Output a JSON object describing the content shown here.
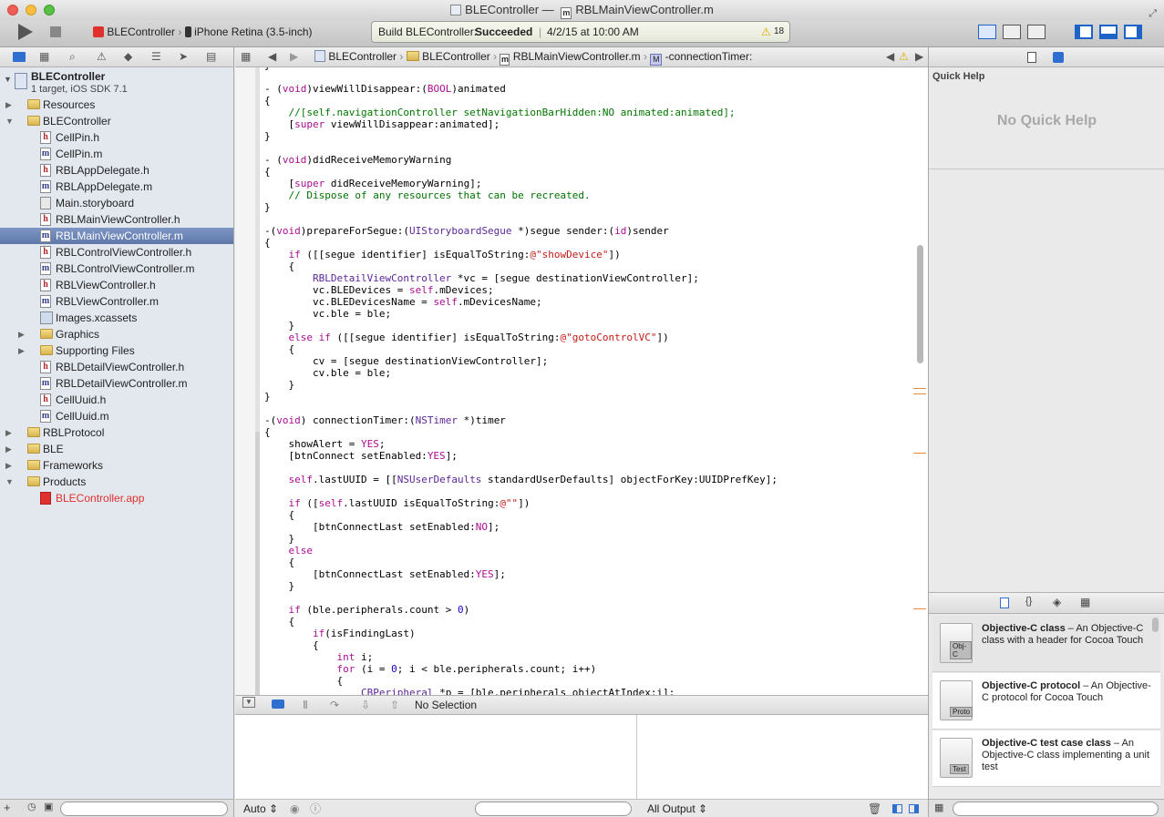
{
  "window": {
    "title": "BLEController — ",
    "file_title": "RBLMainViewController.m"
  },
  "toolbar": {
    "scheme": "BLEController",
    "device": "iPhone Retina (3.5-inch)",
    "status_prefix": "Build BLEController: ",
    "status_result": "Succeeded",
    "status_date": "4/2/15 at 10:00 AM",
    "warnings": "18"
  },
  "navigator": {
    "project": {
      "name": "BLEController",
      "subtitle": "1 target, iOS SDK 7.1"
    },
    "items": [
      {
        "label": "Resources",
        "kind": "folder",
        "indent": 1,
        "tri": "▶"
      },
      {
        "label": "BLEController",
        "kind": "folder",
        "indent": 1,
        "tri": "▼"
      },
      {
        "label": "CellPin.h",
        "kind": "h",
        "indent": 2
      },
      {
        "label": "CellPin.m",
        "kind": "m",
        "indent": 2
      },
      {
        "label": "RBLAppDelegate.h",
        "kind": "h",
        "indent": 2
      },
      {
        "label": "RBLAppDelegate.m",
        "kind": "m",
        "indent": 2
      },
      {
        "label": "Main.storyboard",
        "kind": "sb",
        "indent": 2
      },
      {
        "label": "RBLMainViewController.h",
        "kind": "h",
        "indent": 2
      },
      {
        "label": "RBLMainViewController.m",
        "kind": "m",
        "indent": 2,
        "selected": true
      },
      {
        "label": "RBLControlViewController.h",
        "kind": "h",
        "indent": 2
      },
      {
        "label": "RBLControlViewController.m",
        "kind": "m",
        "indent": 2
      },
      {
        "label": "RBLViewController.h",
        "kind": "h",
        "indent": 2
      },
      {
        "label": "RBLViewController.m",
        "kind": "m",
        "indent": 2
      },
      {
        "label": "Images.xcassets",
        "kind": "assets",
        "indent": 2
      },
      {
        "label": "Graphics",
        "kind": "folder",
        "indent": 2,
        "tri": "▶"
      },
      {
        "label": "Supporting Files",
        "kind": "folder",
        "indent": 2,
        "tri": "▶"
      },
      {
        "label": "RBLDetailViewController.h",
        "kind": "h",
        "indent": 2
      },
      {
        "label": "RBLDetailViewController.m",
        "kind": "m",
        "indent": 2
      },
      {
        "label": "CellUuid.h",
        "kind": "h",
        "indent": 2
      },
      {
        "label": "CellUuid.m",
        "kind": "m",
        "indent": 2
      },
      {
        "label": "RBLProtocol",
        "kind": "folder",
        "indent": 1,
        "tri": "▶"
      },
      {
        "label": "BLE",
        "kind": "folder",
        "indent": 1,
        "tri": "▶"
      },
      {
        "label": "Frameworks",
        "kind": "folder",
        "indent": 1,
        "tri": "▶"
      },
      {
        "label": "Products",
        "kind": "folder",
        "indent": 1,
        "tri": "▼"
      },
      {
        "label": "BLEController.app",
        "kind": "app",
        "indent": 2
      }
    ]
  },
  "jumpbar": {
    "crumb1": "BLEController",
    "crumb2": "BLEController",
    "crumb3": "RBLMainViewController.m",
    "crumb4": "-connectionTimer:"
  },
  "code_lines": [
    "}",
    "",
    "- (void)viewWillDisappear:(BOOL)animated",
    "{",
    "    //[self.navigationController setNavigationBarHidden:NO animated:animated];",
    "    [super viewWillDisappear:animated];",
    "}",
    "",
    "- (void)didReceiveMemoryWarning",
    "{",
    "    [super didReceiveMemoryWarning];",
    "    // Dispose of any resources that can be recreated.",
    "}",
    "",
    "-(void)prepareForSegue:(UIStoryboardSegue *)segue sender:(id)sender",
    "{",
    "    if ([[segue identifier] isEqualToString:@\"showDevice\"])",
    "    {",
    "        RBLDetailViewController *vc = [segue destinationViewController];",
    "        vc.BLEDevices = self.mDevices;",
    "        vc.BLEDevicesName = self.mDevicesName;",
    "        vc.ble = ble;",
    "    }",
    "    else if ([[segue identifier] isEqualToString:@\"gotoControlVC\"])",
    "    {",
    "        cv = [segue destinationViewController];",
    "        cv.ble = ble;",
    "    }",
    "}",
    "",
    "-(void) connectionTimer:(NSTimer *)timer",
    "{",
    "    showAlert = YES;",
    "    [btnConnect setEnabled:YES];",
    "",
    "    self.lastUUID = [[NSUserDefaults standardUserDefaults] objectForKey:UUIDPrefKey];",
    "",
    "    if ([self.lastUUID isEqualToString:@\"\"])",
    "    {",
    "        [btnConnectLast setEnabled:NO];",
    "    }",
    "    else",
    "    {",
    "        [btnConnectLast setEnabled:YES];",
    "    }",
    "",
    "    if (ble.peripherals.count > 0)",
    "    {",
    "        if(isFindingLast)",
    "        {",
    "            int i;",
    "            for (i = 0; i < ble.peripherals.count; i++)",
    "            {",
    "                CBPeripheral *p = [ble.peripherals objectAtIndex:i];"
  ],
  "debug": {
    "selection": "No Selection",
    "auto_label": "Auto",
    "output_label": "All Output"
  },
  "utilities": {
    "quick_help_title": "Quick Help",
    "no_quick_help": "No Quick Help",
    "library": [
      {
        "title": "Objective-C class",
        "desc": " – An Objective-C class with a header for Cocoa Touch",
        "badge": "Obj-C"
      },
      {
        "title": "Objective-C protocol",
        "desc": " – An Objective-C protocol for Cocoa Touch",
        "badge": "Proto"
      },
      {
        "title": "Objective-C test case class",
        "desc": " – An Objective-C class implementing a unit test",
        "badge": "Test"
      }
    ]
  },
  "colors": {
    "selection": "#6a84b6",
    "warning": "#f0b400",
    "status_success": "#000000"
  }
}
